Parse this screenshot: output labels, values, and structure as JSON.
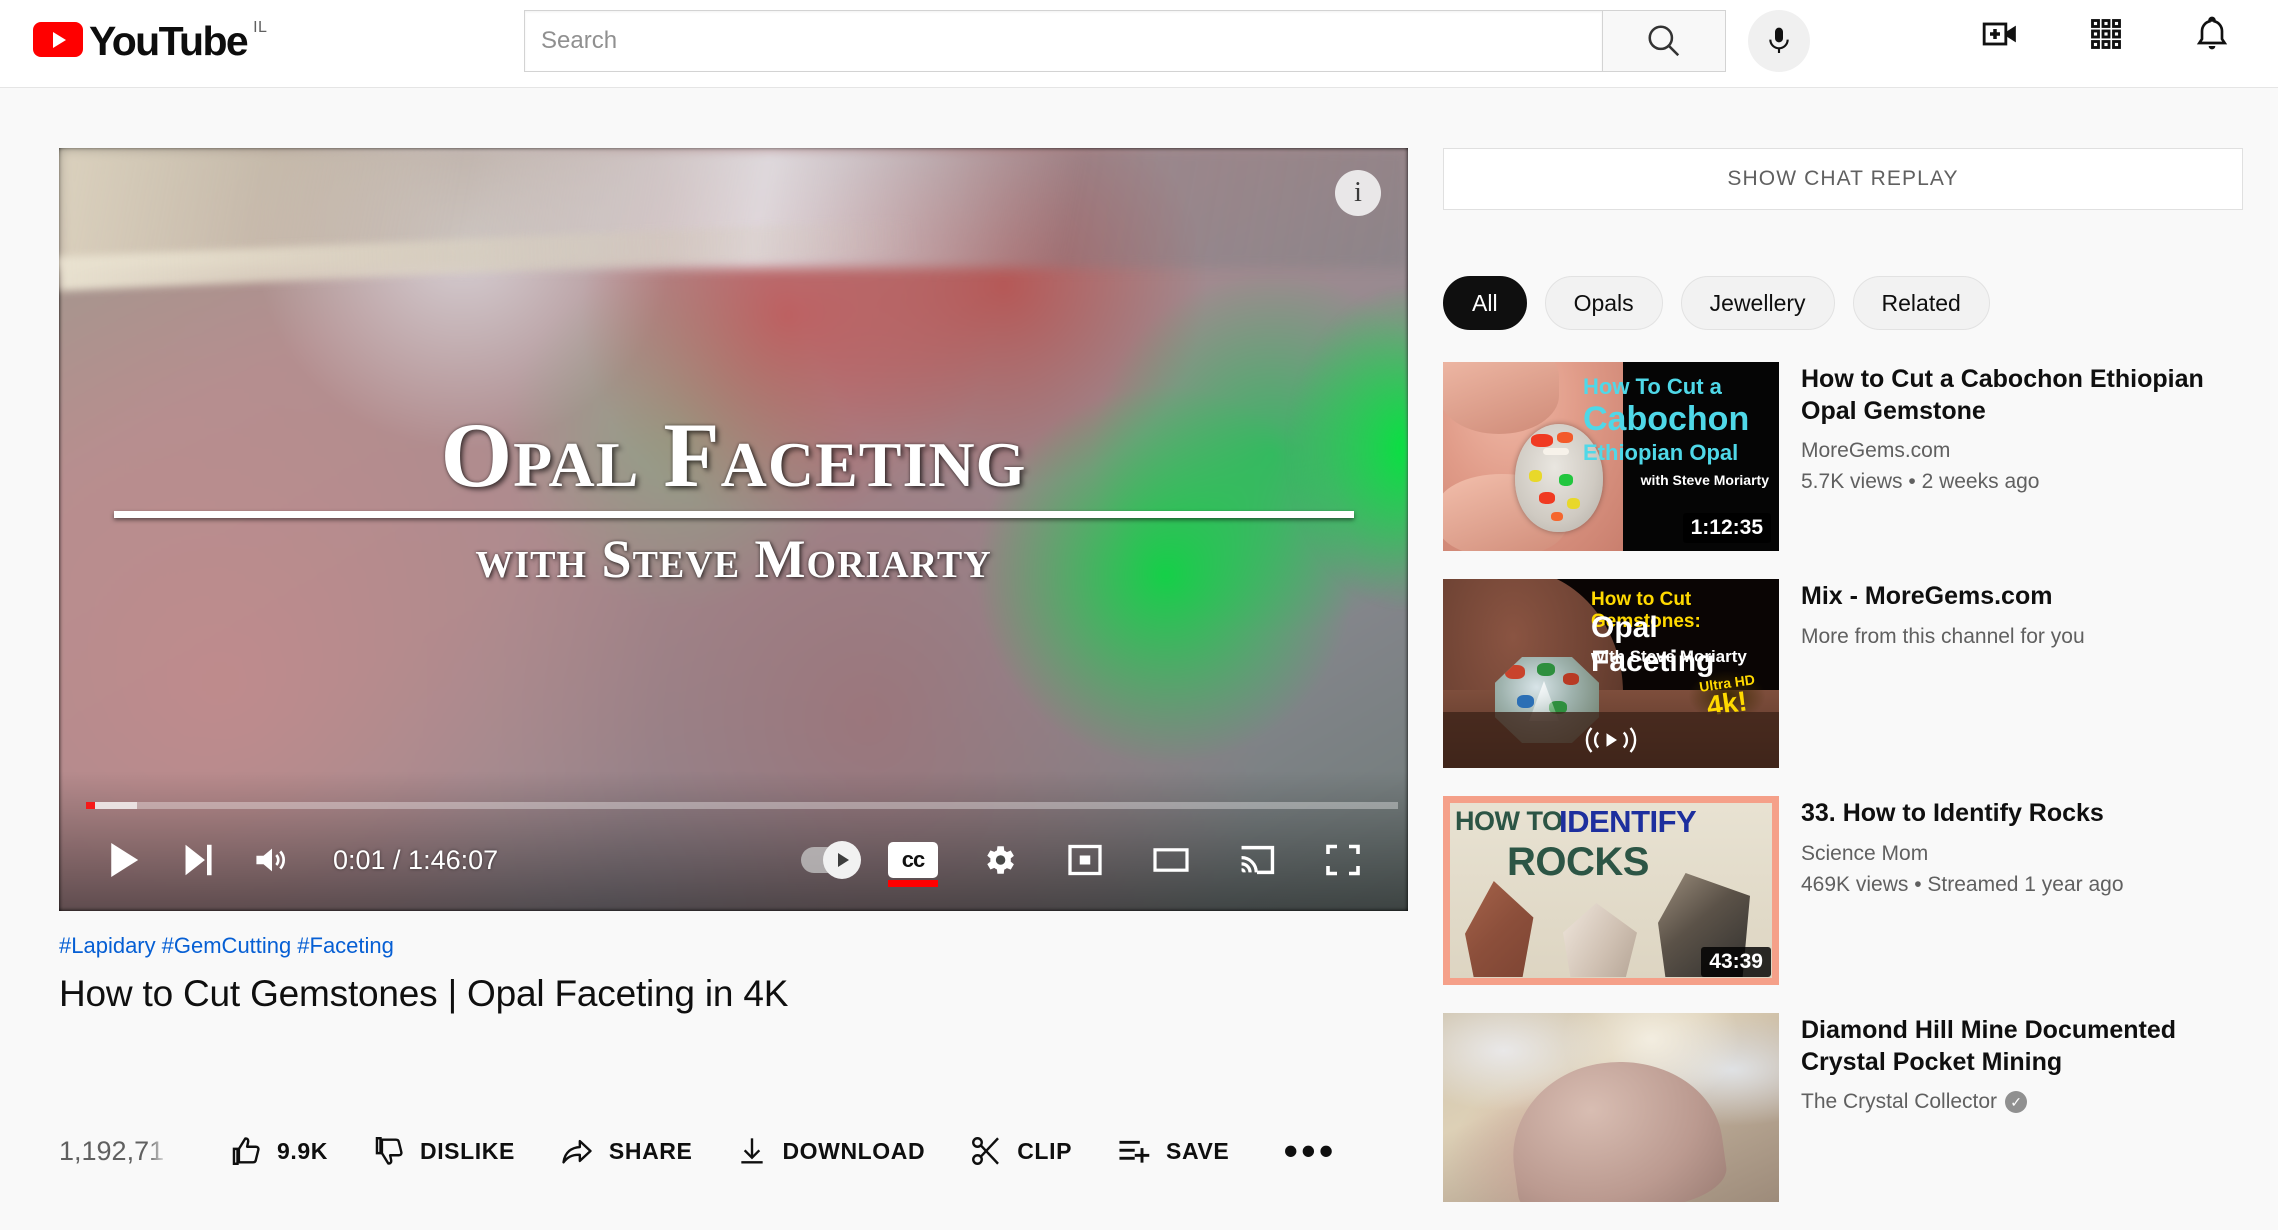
{
  "masthead": {
    "logo_text": "YouTube",
    "country_code": "IL",
    "search": {
      "placeholder": "Search",
      "value": ""
    },
    "icons": {
      "search": "search-icon",
      "mic": "microphone-icon",
      "create": "create-video-icon",
      "apps": "apps-grid-icon",
      "notifications": "bell-icon"
    }
  },
  "player": {
    "overlay_title_line1": "Opal Faceting",
    "overlay_title_line2": "with Steve Moriarty",
    "info_glyph": "i",
    "current_time": "0:01",
    "total_time": "1:46:07",
    "time_display": "0:01 / 1:46:07",
    "progress_percent": 0.7,
    "buffered_percent": 3.9,
    "controls": {
      "play": "Play",
      "next": "Next",
      "volume": "Volume",
      "autoplay": "Autoplay",
      "autoplay_state": "on",
      "subtitles": "CC",
      "subtitles_label": "cc",
      "subtitles_active": true,
      "settings": "Settings",
      "miniplayer": "Miniplayer",
      "theater": "Theater mode",
      "cast": "Play on TV",
      "fullscreen": "Full screen"
    }
  },
  "meta": {
    "hashtags": [
      "#Lapidary",
      "#GemCutting",
      "#Faceting"
    ],
    "title": "How to Cut Gemstones | Opal Faceting in 4K",
    "views": "1,192,71"
  },
  "actions": [
    {
      "label": "9.9K",
      "icon": "thumbs-up-icon",
      "name": "like-button"
    },
    {
      "label": "DISLIKE",
      "icon": "thumbs-down-icon",
      "name": "dislike-button"
    },
    {
      "label": "SHARE",
      "icon": "share-arrow-icon",
      "name": "share-button"
    },
    {
      "label": "DOWNLOAD",
      "icon": "download-arrow-icon",
      "name": "download-button"
    },
    {
      "label": "CLIP",
      "icon": "scissors-icon",
      "name": "clip-button"
    },
    {
      "label": "SAVE",
      "icon": "save-playlist-icon",
      "name": "save-button"
    }
  ],
  "more_actions_label": "•••",
  "sidebar": {
    "chat_replay_label": "SHOW CHAT REPLAY",
    "chips": [
      {
        "label": "All",
        "active": true
      },
      {
        "label": "Opals",
        "active": false
      },
      {
        "label": "Jewellery",
        "active": false
      },
      {
        "label": "Related",
        "active": false
      }
    ],
    "recommendations": [
      {
        "title": "How to Cut a Cabochon Ethiopian Opal Gemstone",
        "channel": "MoreGems.com",
        "stats": "5.7K views • 2 weeks ago",
        "duration": "1:12:35",
        "verified": false,
        "thumb_text": {
          "line1": "How To Cut a",
          "line2": "Cabochon",
          "line3": "Ethiopian Opal",
          "line4": "with Steve Moriarty"
        }
      },
      {
        "title": "Mix - MoreGems.com",
        "channel": "More from this channel for you",
        "stats": "",
        "duration": "",
        "verified": false,
        "thumb_text": {
          "line1": "How to Cut Gemstones:",
          "line2": "Opal Faceting",
          "line3": "with Steve Moriarty",
          "badge_top": "Ultra HD",
          "badge_bottom": "4k!"
        }
      },
      {
        "title": "33. How to Identify Rocks",
        "channel": "Science Mom",
        "stats": "469K views • Streamed 1 year ago",
        "duration": "43:39",
        "verified": false,
        "thumb_text": {
          "line1": "HOW TO",
          "line2": "IDENTIFY",
          "line3": "ROCKS"
        }
      },
      {
        "title": "Diamond Hill Mine Documented Crystal Pocket Mining",
        "channel": "The Crystal Collector",
        "stats": "",
        "duration": "",
        "verified": true,
        "thumb_text": {}
      }
    ]
  },
  "colors": {
    "brand_red": "#ff0000",
    "link_blue": "#065fd4",
    "text_primary": "#0f0f0f",
    "text_secondary": "#606060",
    "page_bg": "#f9f9f9"
  }
}
